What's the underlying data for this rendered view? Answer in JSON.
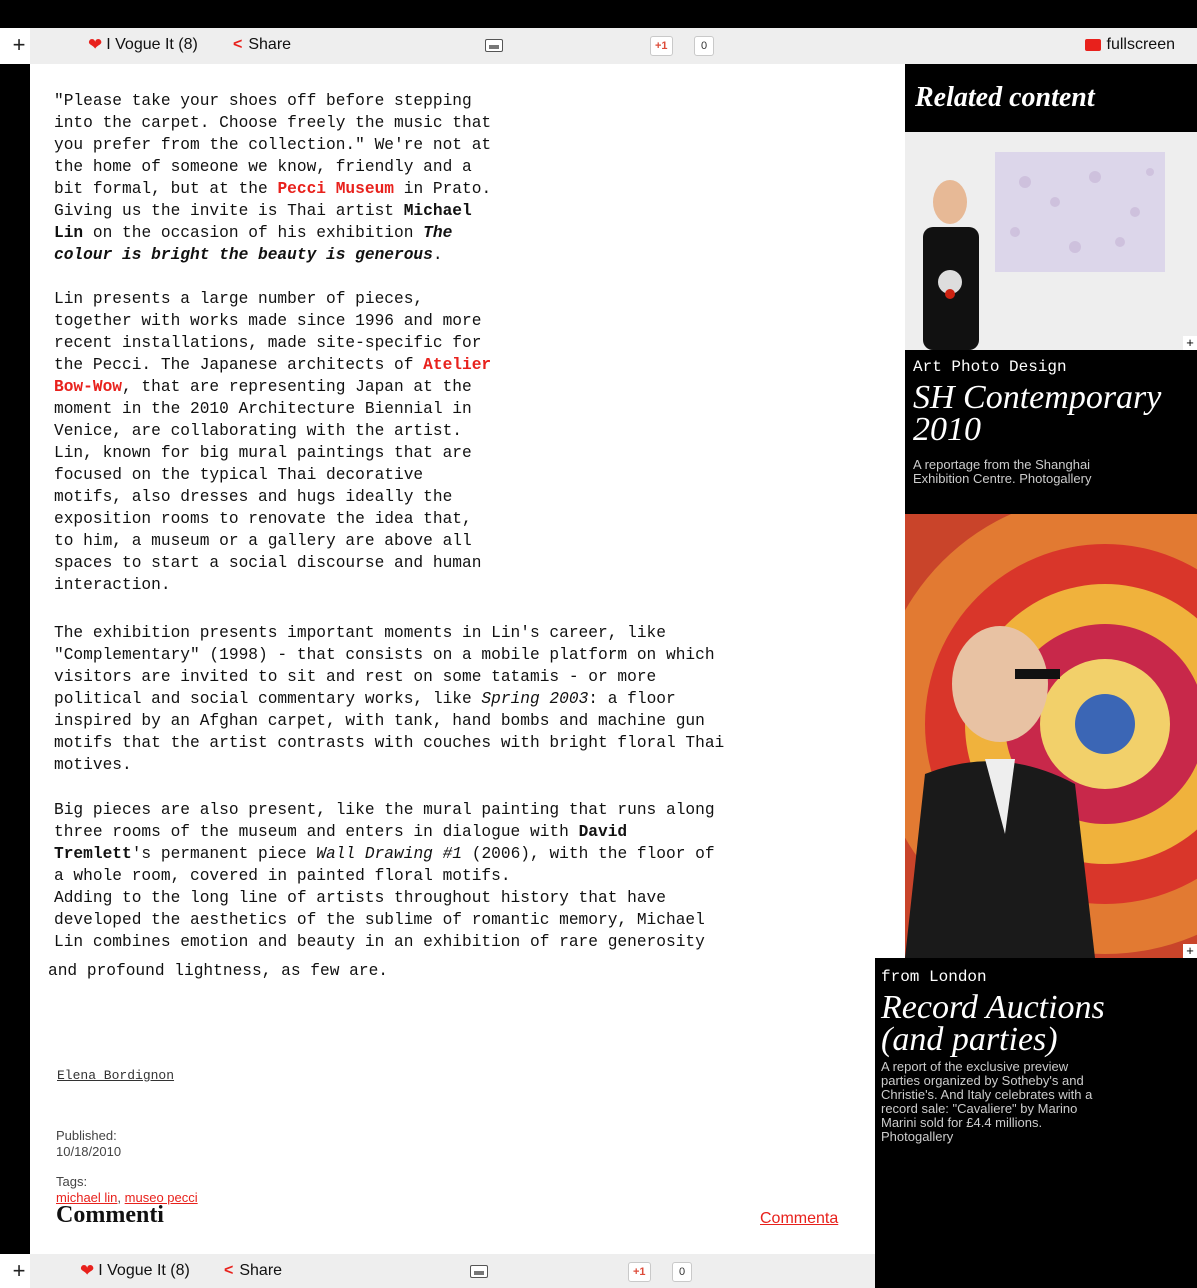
{
  "toolbar": {
    "plus": "+",
    "vogue_label": "I Vogue It (8)",
    "share_label": "Share",
    "gplus_label": "+1",
    "gplus_count": "0",
    "fullscreen_label": "fullscreen"
  },
  "article": {
    "p1_a": "\"Please take your shoes off before stepping\ninto the carpet. Choose freely the music that\nyou prefer from the collection.\" We're not at\nthe home of someone we know, friendly and a\nbit formal, but at the ",
    "p1_link": "Pecci Museum",
    "p1_b": " in Prato.\nGiving us the invite is Thai artist ",
    "p1_bold": "Michael\nLin",
    "p1_c": " on the occasion of his exhibition ",
    "p1_title": "The\ncolour is bright the beauty is generous",
    "p1_d": ".",
    "p2_a": "Lin presents a large number of pieces,\ntogether with works made since 1996 and more\nrecent installations, made site-specific for\nthe Pecci. The Japanese architects of ",
    "p2_link": "Atelier\nBow-Wow",
    "p2_b": ", that are representing Japan at the\nmoment in the 2010 Architecture Biennial in\nVenice, are collaborating with the artist.\nLin, known for big mural paintings that are\nfocused on the typical Thai decorative\nmotifs, also dresses and hugs ideally the\nexposition rooms to renovate the idea that,\nto him, a museum or a gallery are above all\nspaces to start a social discourse and human\ninteraction.",
    "p3_a": "The exhibition presents important moments in Lin's career, like\n\"Complementary\" (1998) - that consists on a mobile platform on which\nvisitors are invited to sit and rest on some tatamis - or more\npolitical and social commentary works, like ",
    "p3_italic": "Spring 2003",
    "p3_b": ": a floor\ninspired by an Afghan carpet, with tank, hand bombs and machine gun\nmotifs that the artist contrasts with couches with bright floral Thai\nmotives.",
    "p4_a": "Big pieces are also present, like the mural painting that runs along\nthree rooms of the museum and enters in dialogue with ",
    "p4_bold": "David\nTremlett",
    "p4_b": "'s permanent piece ",
    "p4_italic": "Wall Drawing #1",
    "p4_c": " (2006), with the floor of\na whole room, covered in painted floral motifs.\nAdding to the long line of artists throughout history that have\ndeveloped the aesthetics of the sublime of romantic memory, Michael\nLin combines emotion and beauty in an exhibition of rare generosity",
    "p4_last": "and profound lightness, as few are.",
    "author": "Elena Bordignon",
    "published_label": "Published:",
    "published_date": "10/18/2010",
    "tags_label": "Tags:",
    "tag1": "michael lin",
    "tag_sep": ", ",
    "tag2": "museo pecci",
    "comments_heading": "Commenti",
    "comment_link": "Commenta"
  },
  "sidebar": {
    "heading": "Related content",
    "item1": {
      "kicker": "Art Photo Design",
      "title": "SH Contemporary\n2010",
      "desc": "A reportage from the Shanghai\nExhibition Centre. Photogallery"
    },
    "item2": {
      "kicker": "from London",
      "title": "Record Auctions\n(and parties)",
      "desc": "A report of the exclusive preview\nparties organized by Sotheby's and\nChristie's. And Italy celebrates with a\nrecord sale: \"Cavaliere\" by Marino\nMarini sold for £4.4 millions.\nPhotogallery"
    },
    "plus": "+"
  },
  "colors": {
    "accent": "#e8211c",
    "toolbar_bg": "#eeeeee",
    "sidebar_bg": "#000000"
  },
  "icons": [
    "plus-icon",
    "heart-icon",
    "share-icon",
    "picture-icon",
    "gplus-icon",
    "fullscreen-icon"
  ]
}
